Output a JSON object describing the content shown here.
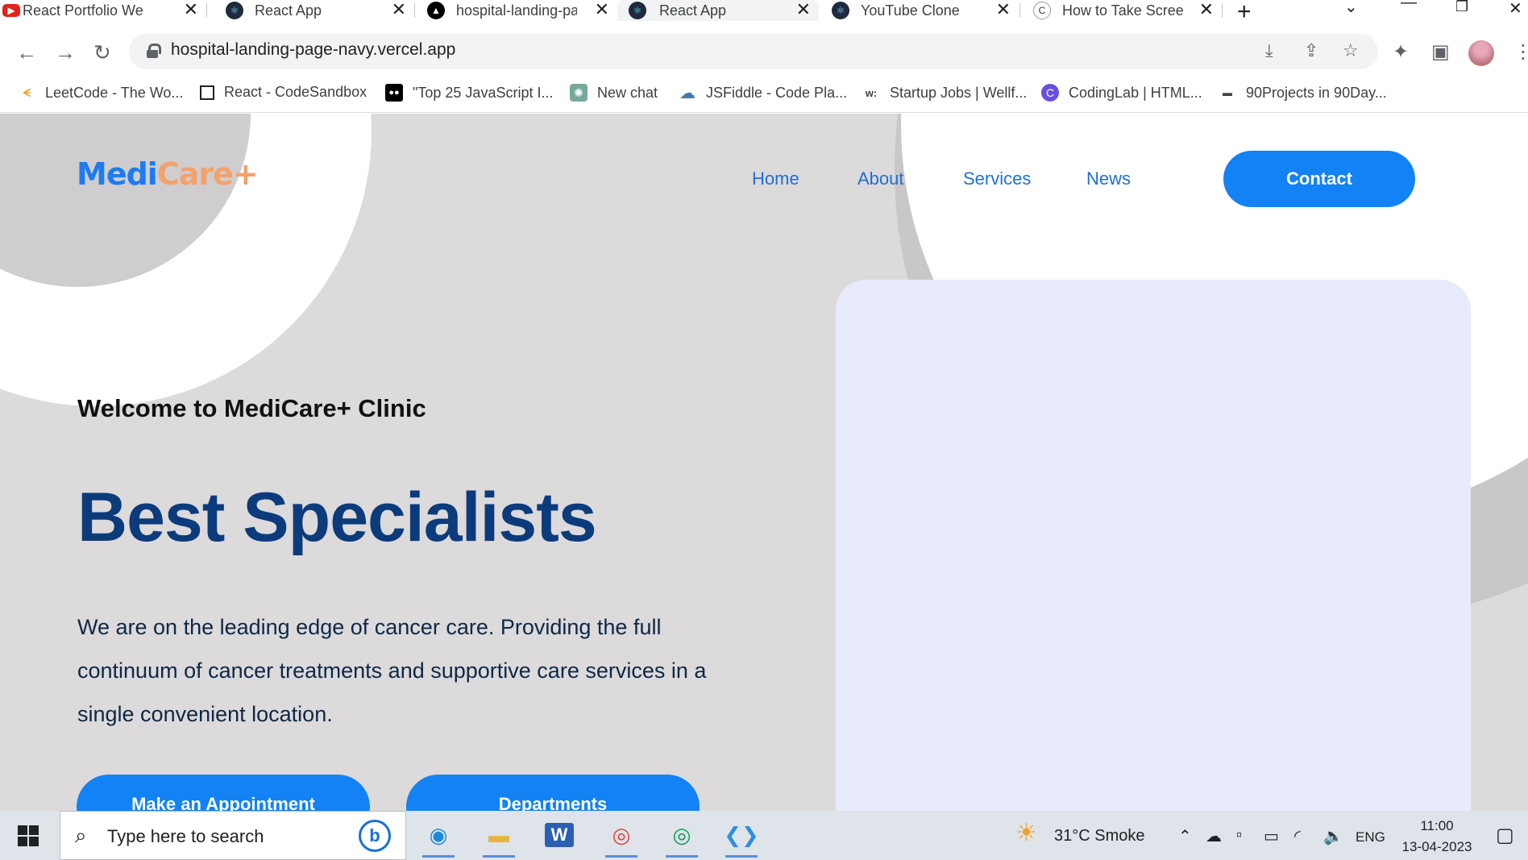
{
  "browser": {
    "tabs": [
      {
        "title": "React Portfolio Web",
        "icon": "youtube-icon",
        "active": false
      },
      {
        "title": "React App",
        "icon": "react-icon",
        "active": false
      },
      {
        "title": "hospital-landing-pa",
        "icon": "vercel-icon",
        "active": false
      },
      {
        "title": "React App",
        "icon": "react-icon",
        "active": true
      },
      {
        "title": "YouTube Clone",
        "icon": "react-icon",
        "active": false
      },
      {
        "title": "How to Take Screer",
        "icon": "screenshot-site-icon",
        "active": false
      }
    ],
    "url": "hospital-landing-page-navy.vercel.app",
    "bookmarks": [
      {
        "label": "LeetCode - The Wo...",
        "icon": "leetcode-icon"
      },
      {
        "label": "React - CodeSandbox",
        "icon": "codesandbox-icon"
      },
      {
        "label": "\"Top 25 JavaScript I...",
        "icon": "medium-icon"
      },
      {
        "label": "New chat",
        "icon": "chatgpt-icon"
      },
      {
        "label": "JSFiddle - Code Pla...",
        "icon": "jsfiddle-icon"
      },
      {
        "label": "Startup Jobs | Wellf...",
        "icon": "wellfound-icon"
      },
      {
        "label": "CodingLab | HTML...",
        "icon": "codinglab-icon"
      },
      {
        "label": "90Projects in 90Day...",
        "icon": "flag-icon"
      }
    ]
  },
  "site": {
    "logo_part1": "Medi",
    "logo_part2": "Care+",
    "nav": [
      "Home",
      "About",
      "Services",
      "News"
    ],
    "contact_label": "Contact",
    "welcome": "Welcome to MediCare+ Clinic",
    "headline": "Best Specialists",
    "description": "We are on the leading edge of cancer care. Providing the full continuum of cancer treatments and supportive care services in a single convenient location.",
    "cta_primary": "Make an Appointment",
    "cta_secondary": "Departments"
  },
  "taskbar": {
    "search_placeholder": "Type here to search",
    "weather": "31°C  Smoke",
    "language": "ENG",
    "time": "11:00",
    "date": "13-04-2023"
  },
  "colors": {
    "brand_blue": "#1282f5",
    "logo_orange": "#f4a26b",
    "headline_navy": "#0c3b7c",
    "page_bg": "#dcdadb",
    "card_bg": "#e8ebfb"
  }
}
